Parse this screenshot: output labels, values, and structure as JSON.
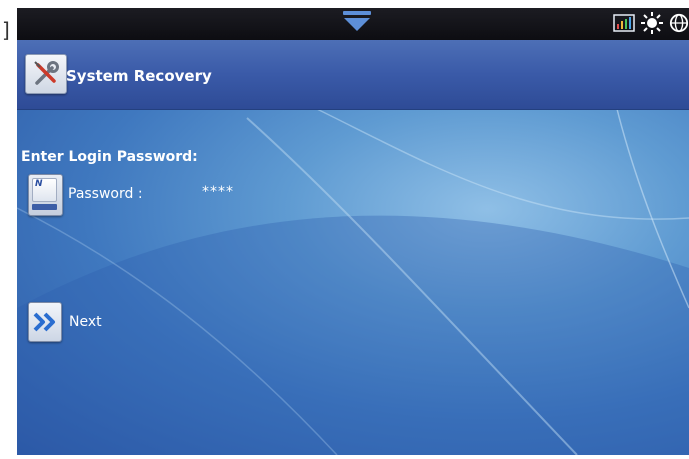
{
  "edge_glyph": "]",
  "status_bar": {
    "pulldown_icon": "triangle-down-icon",
    "icons": [
      "signal-bars-icon",
      "brightness-sun-icon",
      "globe-icon"
    ]
  },
  "header": {
    "tool_icon": "wrench-screwdriver-icon",
    "title": "System Recovery"
  },
  "form": {
    "prompt": "Enter Login Password:",
    "keyboard_icon_letter": "N",
    "password_label": "Password :",
    "password_value": "****"
  },
  "actions": {
    "next_icon": "double-chevron-right-icon",
    "next_label": "Next"
  },
  "colors": {
    "status_bar": "#111118",
    "title_bar": "#3a5aa8",
    "background": "#4f88c8",
    "accent": "#2a6dd0"
  }
}
